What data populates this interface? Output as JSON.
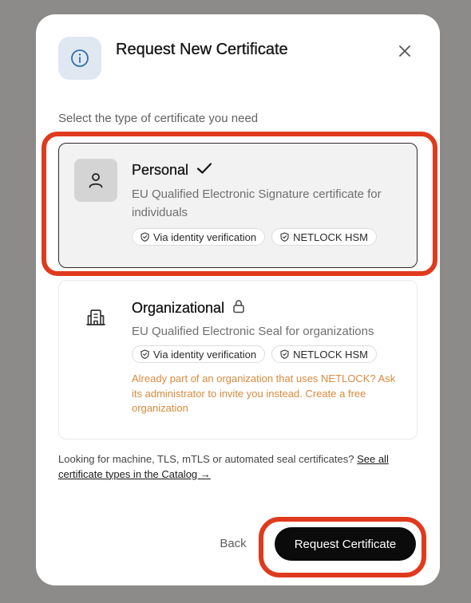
{
  "dialog": {
    "title": "Request New Certificate",
    "subtitle": "Select the type of certificate you need"
  },
  "options": {
    "personal": {
      "title": "Personal",
      "description": "EU Qualified Electronic Signature certificate for individuals",
      "chips": [
        "Via identity verification",
        "NETLOCK HSM"
      ],
      "selected": true,
      "icon": "person-icon"
    },
    "organizational": {
      "title": "Organizational",
      "description": "EU Qualified Electronic Seal for organizations",
      "chips": [
        "Via identity verification",
        "NETLOCK HSM"
      ],
      "locked": true,
      "icon": "building-icon",
      "notice": "Already part of an organization that uses NETLOCK? Ask its administrator to invite you instead. Create a free organization"
    }
  },
  "catalog": {
    "text": "Looking for machine, TLS, mTLS or automated seal certificates?",
    "link": "See all certificate types in the Catalog →"
  },
  "footer": {
    "back_label": "Back",
    "request_label": "Request Certificate"
  },
  "colors": {
    "highlight": "#e03a1e",
    "notice": "#d98a3d",
    "primary": "#0b0b0b",
    "info_bg": "#dfe8f1",
    "info_icon": "#2f6fb3"
  }
}
